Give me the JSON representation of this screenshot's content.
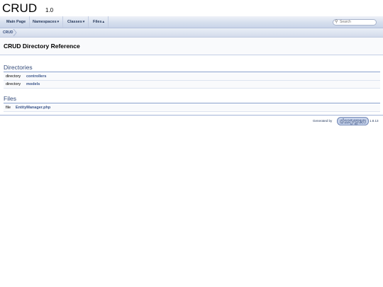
{
  "project": {
    "name": "CRUD",
    "number": "1.0"
  },
  "nav": {
    "tabs": [
      {
        "label": "Main Page"
      },
      {
        "label": "Namespaces",
        "caret": "▾"
      },
      {
        "label": "Classes",
        "caret": "▾"
      },
      {
        "label": "Files",
        "caret": "▴"
      }
    ],
    "search": {
      "placeholder": "Search",
      "icon": "search-icon"
    }
  },
  "breadcrumb": {
    "items": [
      "CRUD"
    ]
  },
  "header": {
    "title": "CRUD Directory Reference"
  },
  "directories": {
    "heading": "Directories",
    "rows": [
      {
        "kind": "directory",
        "name": "controllers"
      },
      {
        "kind": "directory",
        "name": "models"
      }
    ]
  },
  "files": {
    "heading": "Files",
    "rows": [
      {
        "kind": "file",
        "name": "EntityManager.php"
      }
    ]
  },
  "footer": {
    "generated_by": "Generated by",
    "logo": "doxygen",
    "version": "1.8.13"
  },
  "colors": {
    "accent": "#3d578c",
    "nav_bg": "#d6dfee",
    "rule": "#879ecb"
  }
}
